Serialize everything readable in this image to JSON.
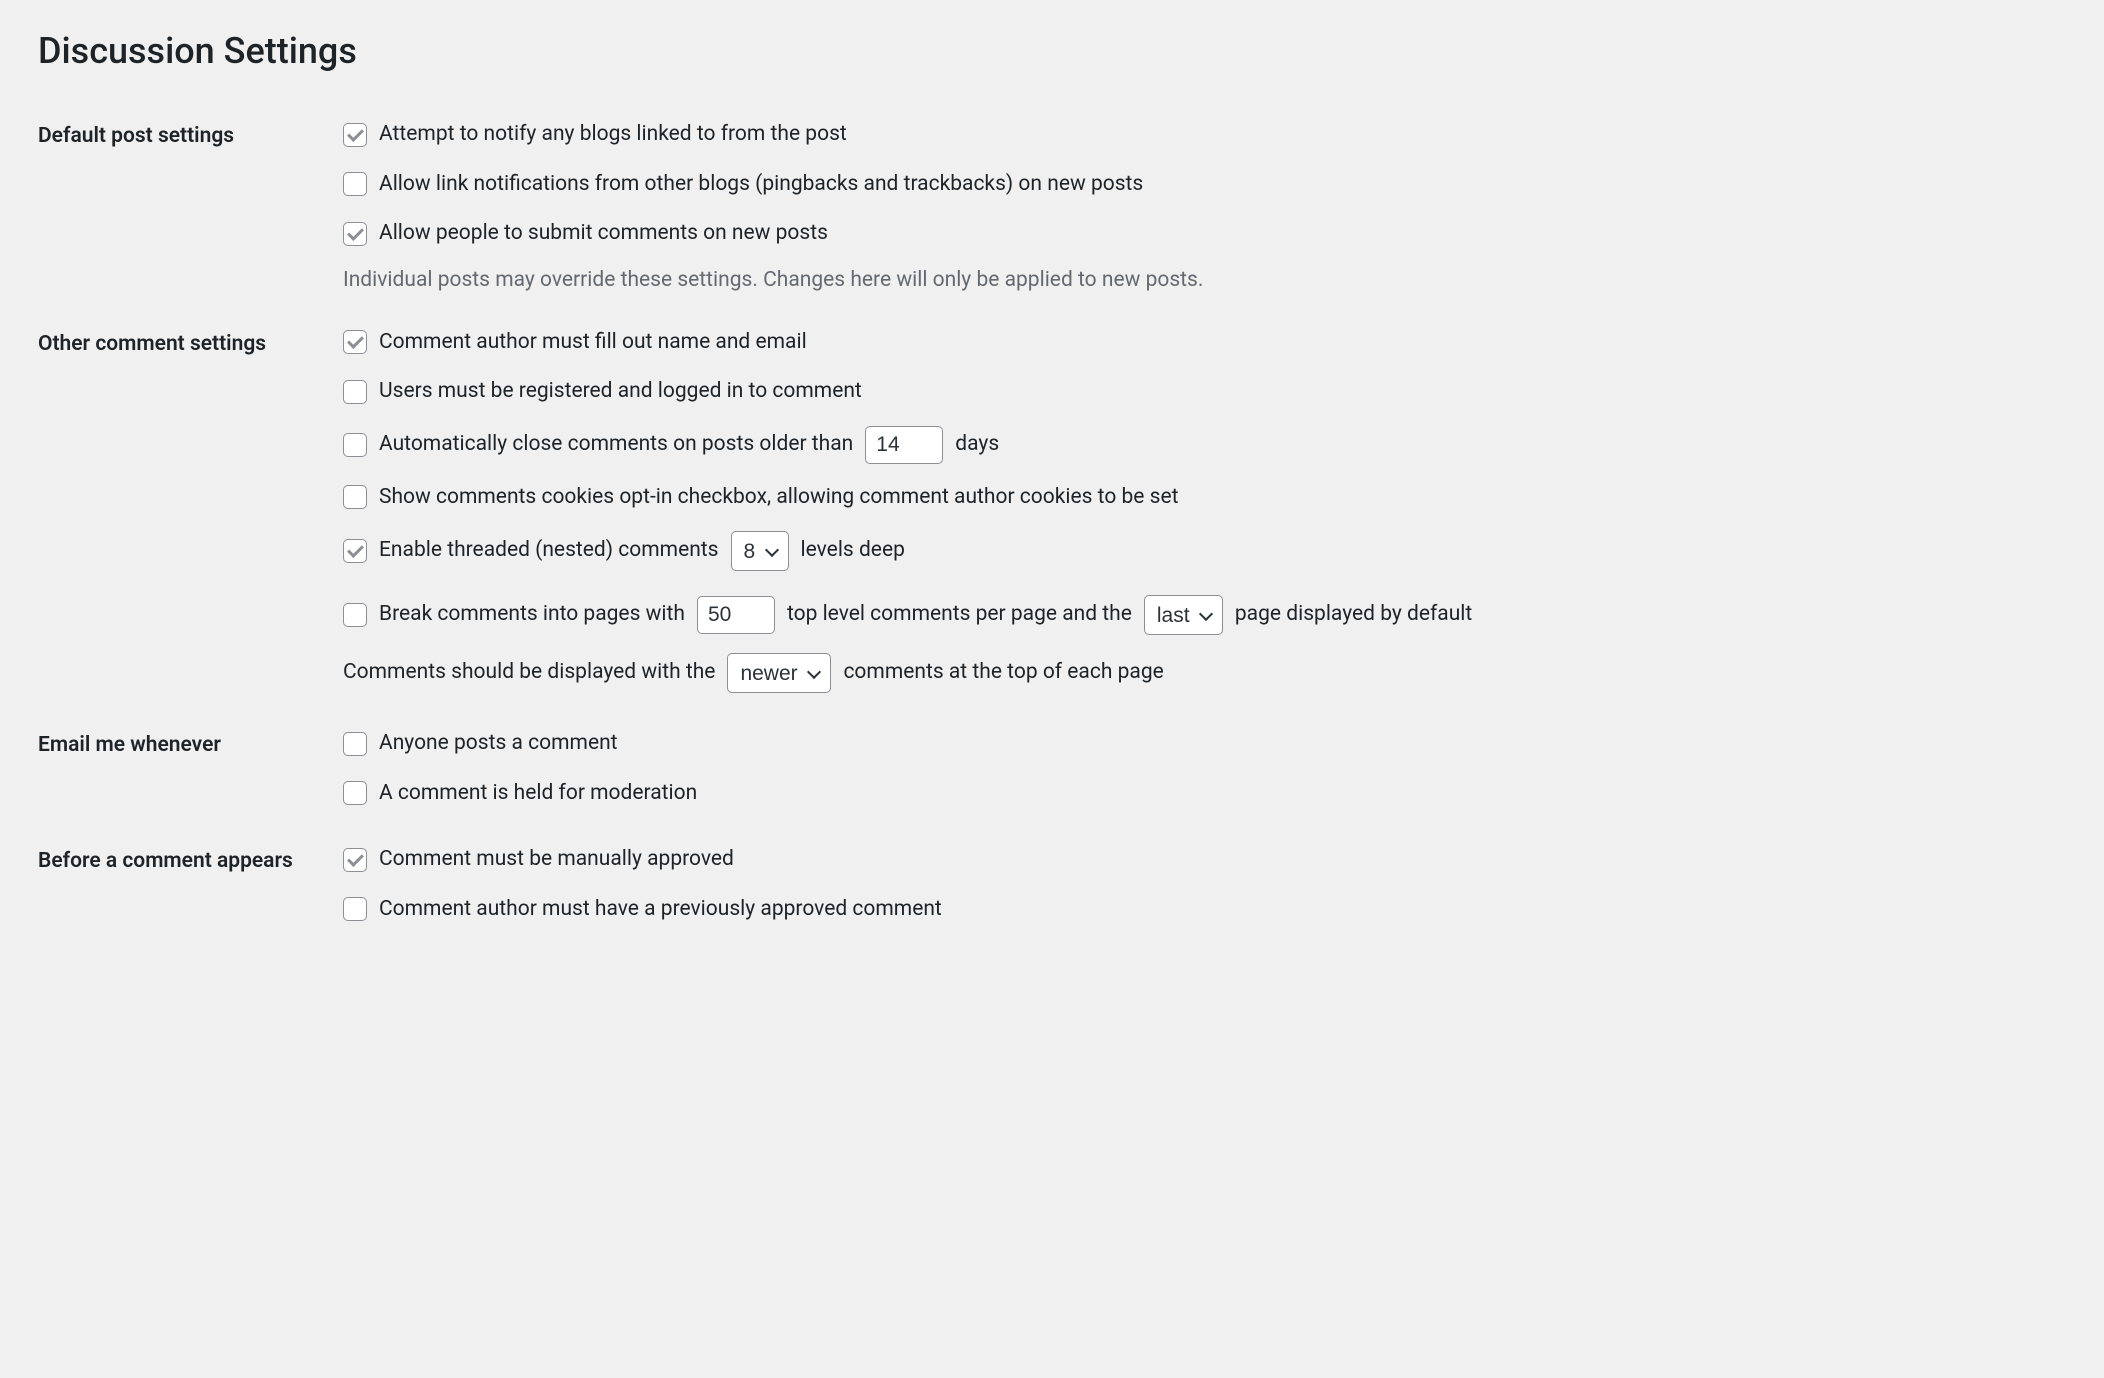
{
  "page_title": "Discussion Settings",
  "sections": {
    "default_post": {
      "heading": "Default post settings",
      "notify_blogs": {
        "label": "Attempt to notify any blogs linked to from the post",
        "checked": true
      },
      "allow_pingbacks": {
        "label": "Allow link notifications from other blogs (pingbacks and trackbacks) on new posts",
        "checked": false
      },
      "allow_comments": {
        "label": "Allow people to submit comments on new posts",
        "checked": true
      },
      "note": "Individual posts may override these settings. Changes here will only be applied to new posts."
    },
    "other_comment": {
      "heading": "Other comment settings",
      "require_name_email": {
        "label": "Comment author must fill out name and email",
        "checked": true
      },
      "require_registration": {
        "label": "Users must be registered and logged in to comment",
        "checked": false
      },
      "auto_close": {
        "label_before": "Automatically close comments on posts older than",
        "value": "14",
        "label_after": "days",
        "checked": false
      },
      "cookies_optin": {
        "label": "Show comments cookies opt-in checkbox, allowing comment author cookies to be set",
        "checked": false
      },
      "threaded": {
        "label_before": "Enable threaded (nested) comments",
        "value": "8",
        "label_after": "levels deep",
        "checked": true
      },
      "pagination": {
        "label_before": "Break comments into pages with",
        "per_page": "50",
        "mid": "top level comments per page and the",
        "page_pos": "last",
        "label_after": "page displayed by default",
        "checked": false
      },
      "order": {
        "label_before": "Comments should be displayed with the",
        "value": "newer",
        "label_after": "comments at the top of each page"
      }
    },
    "email_me": {
      "heading": "Email me whenever",
      "anyone_posts": {
        "label": "Anyone posts a comment",
        "checked": false
      },
      "held_moderation": {
        "label": "A comment is held for moderation",
        "checked": false
      }
    },
    "before_appears": {
      "heading": "Before a comment appears",
      "manually_approved": {
        "label": "Comment must be manually approved",
        "checked": true
      },
      "prev_approved": {
        "label": "Comment author must have a previously approved comment",
        "checked": false
      }
    }
  }
}
